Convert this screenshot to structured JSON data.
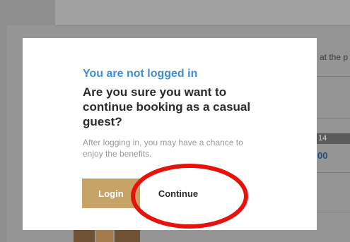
{
  "background": {
    "side_text": "at the p",
    "price_badge": "14",
    "price_value": "00"
  },
  "modal": {
    "title": "You are not logged in",
    "question": "Are you sure you want to continue booking as a casual guest?",
    "note": "After logging in, you may have a chance to enjoy the benefits.",
    "login_label": "Login",
    "continue_label": "Continue"
  },
  "colors": {
    "title": "#3d8ed6",
    "login_button": "#c8a367",
    "overlay": "#8f8f8f",
    "annotation": "#e8120c"
  }
}
